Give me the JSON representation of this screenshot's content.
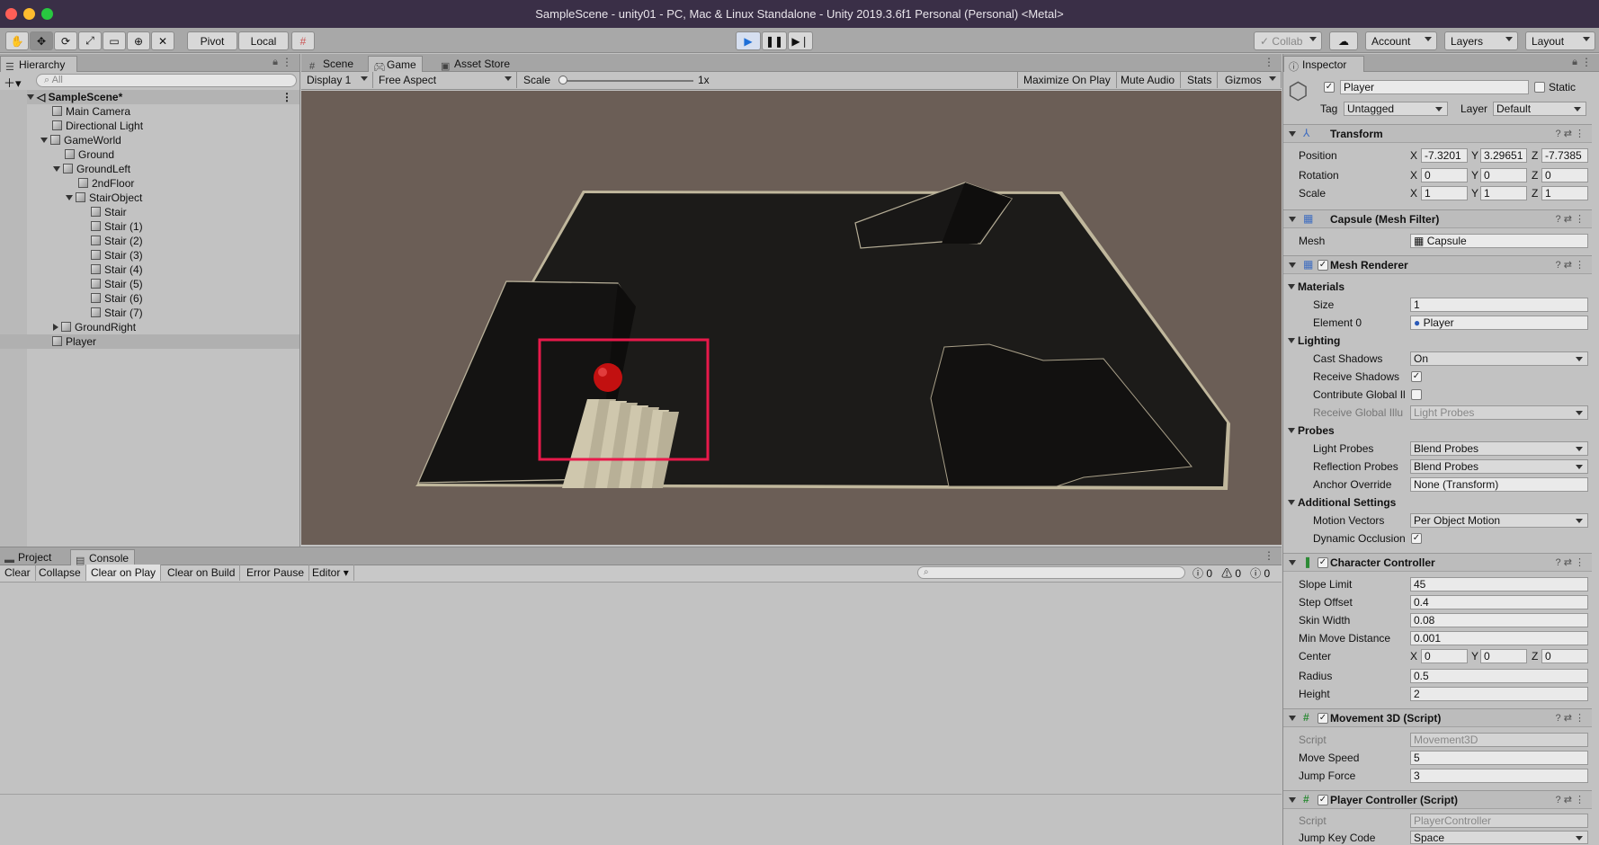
{
  "window": {
    "title": "SampleScene - unity01 - PC, Mac & Linux Standalone - Unity 2019.3.6f1 Personal (Personal) <Metal>"
  },
  "toolbar": {
    "pivot": "Pivot",
    "local": "Local",
    "collab": "Collab",
    "account": "Account",
    "layers": "Layers",
    "layout": "Layout"
  },
  "hierarchy": {
    "tab": "Hierarchy",
    "search_placeholder": "All",
    "scene": "SampleScene*",
    "items": [
      {
        "label": "Main Camera"
      },
      {
        "label": "Directional Light"
      },
      {
        "label": "GameWorld"
      },
      {
        "label": "Ground"
      },
      {
        "label": "GroundLeft"
      },
      {
        "label": "2ndFloor"
      },
      {
        "label": "StairObject"
      },
      {
        "label": "Stair"
      },
      {
        "label": "Stair (1)"
      },
      {
        "label": "Stair (2)"
      },
      {
        "label": "Stair (3)"
      },
      {
        "label": "Stair (4)"
      },
      {
        "label": "Stair (5)"
      },
      {
        "label": "Stair (6)"
      },
      {
        "label": "Stair (7)"
      },
      {
        "label": "GroundRight"
      },
      {
        "label": "Player"
      }
    ]
  },
  "center_tabs": {
    "scene": "Scene",
    "game": "Game",
    "asset_store": "Asset Store"
  },
  "game_bar": {
    "display": "Display 1",
    "aspect": "Free Aspect",
    "scale_label": "Scale",
    "scale_value": "1x",
    "maximize": "Maximize On Play",
    "mute": "Mute Audio",
    "stats": "Stats",
    "gizmos": "Gizmos"
  },
  "bottom_tabs": {
    "project": "Project",
    "console": "Console"
  },
  "console": {
    "clear": "Clear",
    "collapse": "Collapse",
    "clear_on_play": "Clear on Play",
    "clear_on_build": "Clear on Build",
    "error_pause": "Error Pause",
    "editor": "Editor",
    "count_info": "0",
    "count_warn": "0",
    "count_err": "0"
  },
  "inspector": {
    "tab": "Inspector",
    "object_name": "Player",
    "static": "Static",
    "tag_label": "Tag",
    "tag_value": "Untagged",
    "layer_label": "Layer",
    "layer_value": "Default",
    "transform": {
      "title": "Transform",
      "position_label": "Position",
      "pos_x": "-7.3201",
      "pos_y": "3.29651",
      "pos_z": "-7.7385",
      "rotation_label": "Rotation",
      "rot_x": "0",
      "rot_y": "0",
      "rot_z": "0",
      "scale_label": "Scale",
      "sc_x": "1",
      "sc_y": "1",
      "sc_z": "1"
    },
    "mesh_filter": {
      "title": "Capsule (Mesh Filter)",
      "mesh_label": "Mesh",
      "mesh_value": "Capsule"
    },
    "mesh_renderer": {
      "title": "Mesh Renderer",
      "materials": "Materials",
      "size_label": "Size",
      "size_value": "1",
      "element0_label": "Element 0",
      "element0_value": "Player",
      "lighting": "Lighting",
      "cast_shadows_label": "Cast Shadows",
      "cast_shadows_value": "On",
      "receive_shadows_label": "Receive Shadows",
      "contribute_gi_label": "Contribute Global Il",
      "receive_gi_label": "Receive Global Illu",
      "receive_gi_value": "Light Probes",
      "probes": "Probes",
      "light_probes_label": "Light Probes",
      "light_probes_value": "Blend Probes",
      "reflection_probes_label": "Reflection Probes",
      "reflection_probes_value": "Blend Probes",
      "anchor_override_label": "Anchor Override",
      "anchor_override_value": "None (Transform)",
      "additional": "Additional Settings",
      "motion_vectors_label": "Motion Vectors",
      "motion_vectors_value": "Per Object Motion",
      "dynamic_occlusion_label": "Dynamic Occlusion"
    },
    "character_controller": {
      "title": "Character Controller",
      "slope_label": "Slope Limit",
      "slope_value": "45",
      "step_label": "Step Offset",
      "step_value": "0.4",
      "skin_label": "Skin Width",
      "skin_value": "0.08",
      "minmove_label": "Min Move Distance",
      "minmove_value": "0.001",
      "center_label": "Center",
      "c_x": "0",
      "c_y": "0",
      "c_z": "0",
      "radius_label": "Radius",
      "radius_value": "0.5",
      "height_label": "Height",
      "height_value": "2"
    },
    "movement3d": {
      "title": "Movement 3D (Script)",
      "script_label": "Script",
      "script_value": "Movement3D",
      "speed_label": "Move Speed",
      "speed_value": "5",
      "jump_label": "Jump Force",
      "jump_value": "3"
    },
    "player_controller": {
      "title": "Player Controller (Script)",
      "script_label": "Script",
      "script_value": "PlayerController",
      "jumpkey_label": "Jump Key Code",
      "jumpkey_value": "Space"
    }
  },
  "colors": {
    "highlight_box": "#e8194a",
    "ball": "#c21010",
    "game_bg": "#6b5e56"
  }
}
